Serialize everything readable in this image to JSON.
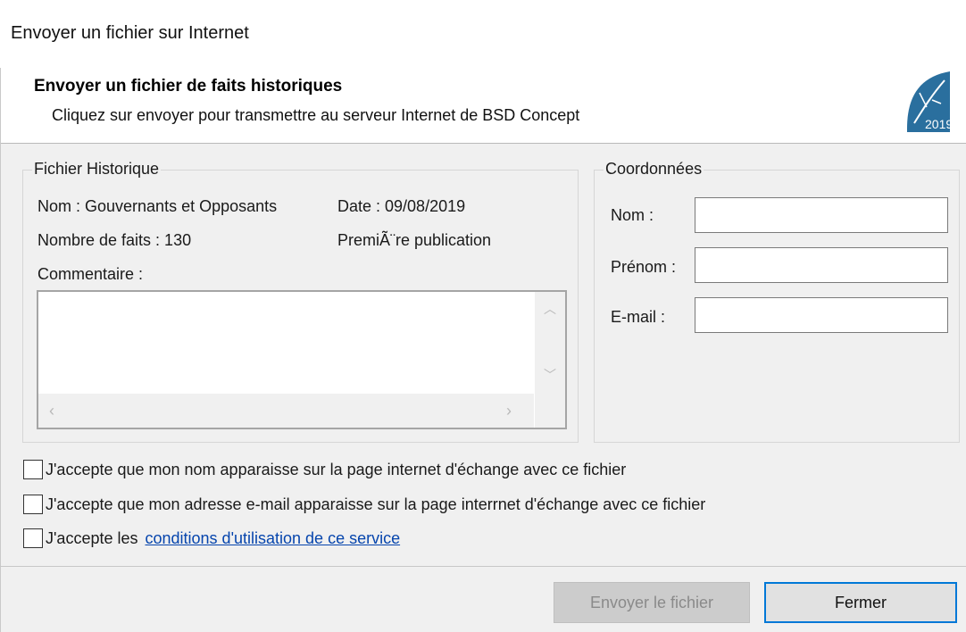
{
  "window": {
    "title": "Envoyer un fichier sur Internet"
  },
  "header": {
    "title": "Envoyer un fichier de faits historiques",
    "subtitle": "Cliquez sur envoyer pour transmettre au serveur Internet de BSD Concept",
    "logo_text": "2019",
    "logo_icon": "leaf-logo-icon",
    "logo_color": "#2a6f9e"
  },
  "history_group": {
    "legend": "Fichier Historique",
    "name_label": "Nom : Gouvernants et Opposants",
    "date_label": "Date : 09/08/2019",
    "facts_label": "Nombre de faits : 130",
    "publication_label": "PremiÃ¨re publication",
    "comment_label": "Commentaire :",
    "comment_value": ""
  },
  "contact_group": {
    "legend": "Coordonnées",
    "nom_label": "Nom :",
    "nom_value": "",
    "prenom_label": "Prénom :",
    "prenom_value": "",
    "email_label": "E-mail :",
    "email_value": ""
  },
  "checkboxes": [
    {
      "label": "J'accepte que mon nom apparaisse sur la page internet d'échange avec ce fichier",
      "checked": false
    },
    {
      "label": "J'accepte que mon adresse e-mail apparaisse sur la page interrnet d'échange avec ce fichier",
      "checked": false
    },
    {
      "label": "J'accepte les",
      "link": "conditions d'utilisation de ce service",
      "checked": false
    }
  ],
  "buttons": {
    "send": "Envoyer le fichier",
    "close": "Fermer"
  },
  "colors": {
    "focus_border": "#0078d7",
    "link": "#0645ad",
    "disabled_button": "#cccccc"
  }
}
